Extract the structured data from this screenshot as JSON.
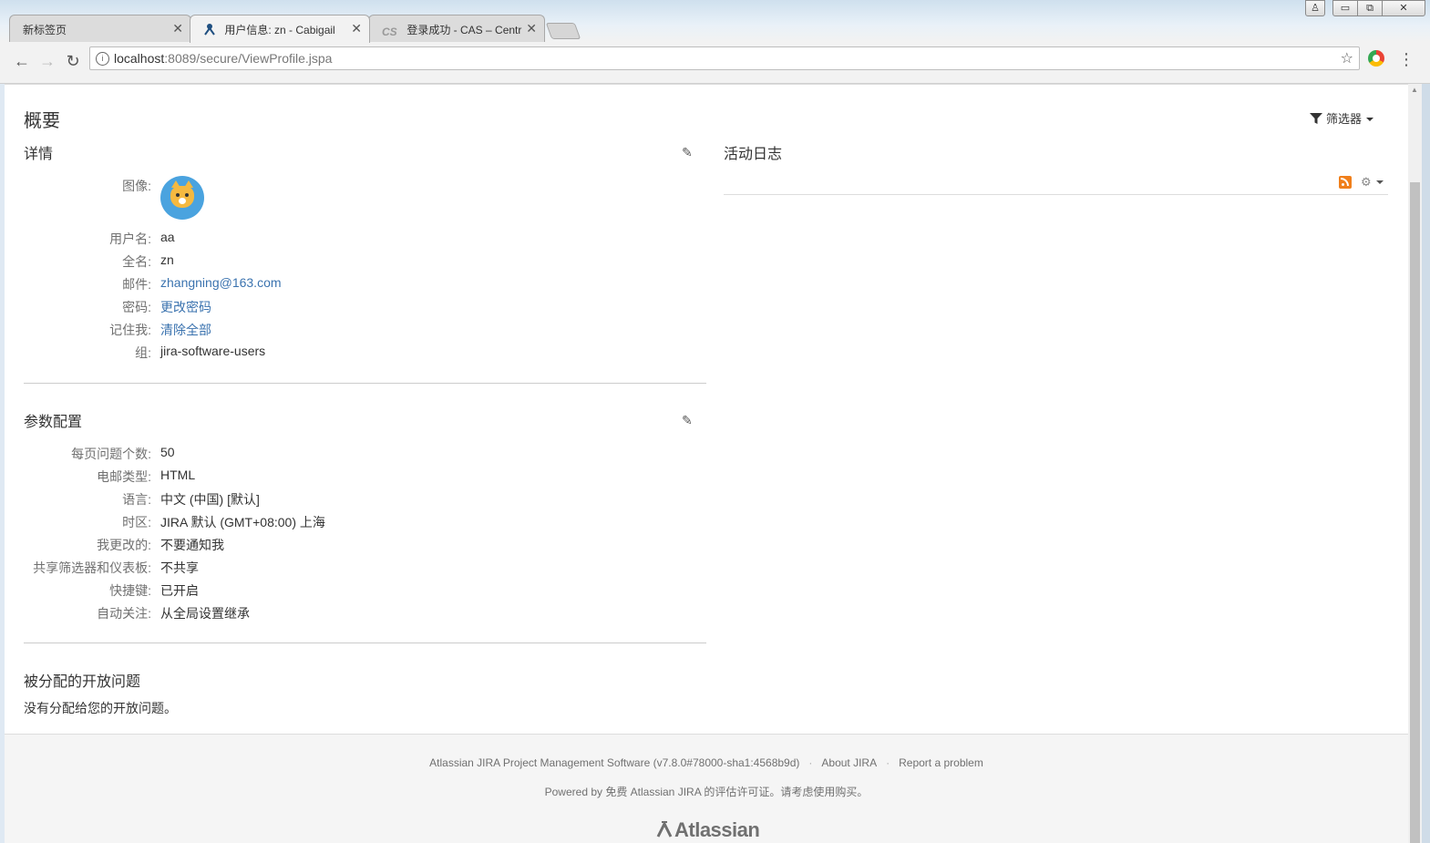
{
  "browser": {
    "tabs": [
      {
        "label": "新标签页"
      },
      {
        "label": "用户信息: zn - Cabigail"
      },
      {
        "label": "登录成功 - CAS – Centr"
      }
    ],
    "address_host": "localhost",
    "address_rest": ":8089/secure/ViewProfile.jspa"
  },
  "page": {
    "title": "概要",
    "filter_label": "筛选器",
    "details": {
      "title": "详情",
      "fields": [
        {
          "label": "图像:",
          "value": ""
        },
        {
          "label": "用户名:",
          "value": "aa"
        },
        {
          "label": "全名:",
          "value": "zn"
        },
        {
          "label": "邮件:",
          "value": "zhangning@163.com"
        },
        {
          "label": "密码:",
          "value": "更改密码"
        },
        {
          "label": "记住我:",
          "value": "清除全部"
        },
        {
          "label": "组:",
          "value": "jira-software-users"
        }
      ]
    },
    "preferences": {
      "title": "参数配置",
      "fields": [
        {
          "label": "每页问题个数:",
          "value": "50"
        },
        {
          "label": "电邮类型:",
          "value": "HTML"
        },
        {
          "label": "语言:",
          "value": "中文 (中国) [默认]"
        },
        {
          "label": "时区:",
          "value": "JIRA 默认 (GMT+08:00) 上海"
        },
        {
          "label": "我更改的:",
          "value": "不要通知我"
        },
        {
          "label": "共享筛选器和仪表板:",
          "value": "不共享"
        },
        {
          "label": "快捷键:",
          "value": "已开启"
        },
        {
          "label": "自动关注:",
          "value": "从全局设置继承"
        }
      ]
    },
    "assigned": {
      "title": "被分配的开放问题",
      "empty_text": "没有分配给您的开放问题。"
    },
    "activity": {
      "title": "活动日志"
    },
    "footer": {
      "line1_software": "Atlassian JIRA Project Management Software (v7.8.0#78000-sha1:4568b9d)",
      "line1_about": "About JIRA",
      "line1_report": "Report a problem",
      "line2": "Powered by 免费 Atlassian JIRA 的评估许可证。请考虑使用购买。",
      "logo": "Atlassian"
    }
  },
  "colors": {
    "link": "#3b73af",
    "label": "#707070",
    "avatar_bg": "#4aa3df",
    "rss": "#f07f1b"
  }
}
